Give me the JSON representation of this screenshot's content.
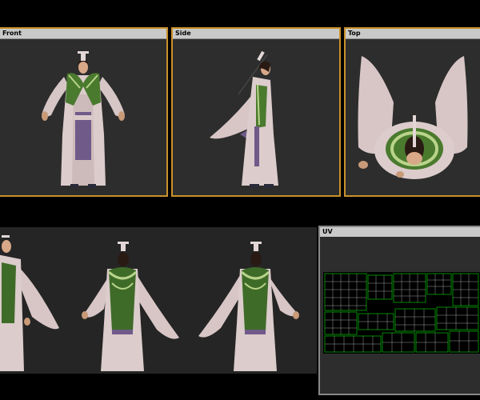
{
  "viewports": {
    "front": {
      "title": "Front"
    },
    "side": {
      "title": "Side"
    },
    "top": {
      "title": "Top"
    },
    "uv": {
      "title": "UV"
    }
  },
  "colors": {
    "active_border": "#c8922a",
    "viewport_bg": "#2d2d2d",
    "header_bg": "#c9c9c9",
    "robe": "#d9c9c9",
    "robe_shadow": "#b9a6a6",
    "green_cloth": "#3f6b28",
    "green_trim": "#a6c76b",
    "purple_sash": "#6f5a8a",
    "uv_wire": "#00c000"
  }
}
